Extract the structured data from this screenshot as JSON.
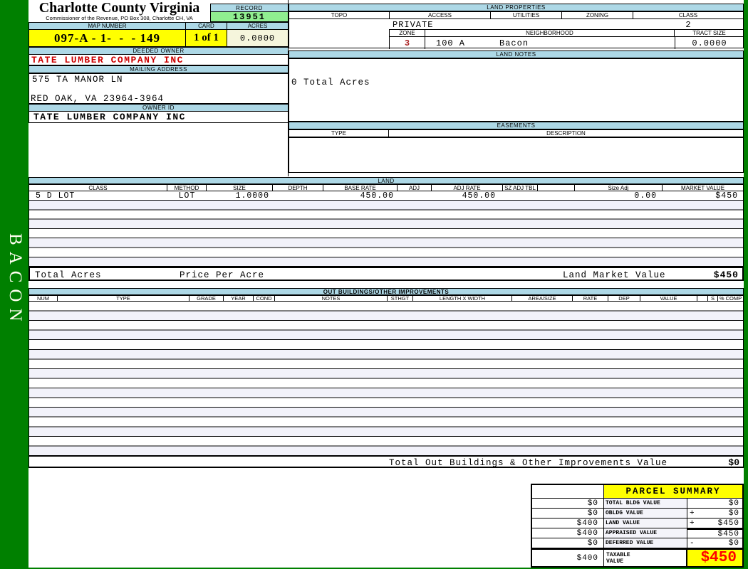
{
  "page": {
    "sidebar_text": "BACON"
  },
  "colors": {
    "frame_green": "#008000",
    "header_blue": "#ADD8E6",
    "highlight_yellow": "#FFFF00",
    "record_green": "#90EE90",
    "acres_cream": "#F5F5DC",
    "owner_red": "#CC0000",
    "taxable_red": "#FF0000"
  },
  "header": {
    "county": "Charlotte County Virginia",
    "commissioner": "Commissioner of the Revenue, PO Box 308, Charlotte CH, VA"
  },
  "record": {
    "label": "RECORD",
    "value": "13951"
  },
  "map": {
    "label": "MAP NUMBER",
    "value": "097-A - 1-  -  - 149"
  },
  "card": {
    "label": "CARD",
    "value": "1 of 1"
  },
  "acres": {
    "label": "ACRES",
    "value": "0.0000"
  },
  "deeded_owner": {
    "label": "DEEDED OWNER",
    "value": "TATE LUMBER COMPANY INC"
  },
  "mailing": {
    "label": "MAILING ADDRESS",
    "line1": "575 TA MANOR LN",
    "line2": "RED OAK, VA 23964-3964"
  },
  "owner_id": {
    "label": "OWNER ID",
    "value": "TATE LUMBER COMPANY INC"
  },
  "land_properties": {
    "title": "LAND PROPERTIES",
    "headers": [
      "TOPO",
      "ACCESS",
      "UTILITIES",
      "ZONING",
      "CLASS"
    ],
    "access_value": "PRIVATE",
    "class_value": "2",
    "zone_label": "ZONE",
    "zone_value": "3",
    "neighborhood_label": "NEIGHBORHOOD",
    "neighborhood_code": "100 A",
    "neighborhood_name": "Bacon",
    "tract_label": "TRACT SIZE",
    "tract_value": "0.0000"
  },
  "land_notes": {
    "title": "LAND NOTES",
    "text": "0 Total Acres"
  },
  "easements": {
    "title": "EASEMENTS",
    "type_label": "TYPE",
    "description_label": "DESCRIPTION"
  },
  "land_table": {
    "title": "LAND",
    "headers": [
      "CLASS",
      "METHOD",
      "SIZE",
      "DEPTH",
      "BASE RATE",
      "ADJ",
      "ADJ RATE",
      "SZ ADJ TBL",
      "",
      "Size Adj",
      "MARKET VALUE"
    ],
    "row": {
      "class": "5 D LOT",
      "method": "LOT",
      "size": "1.0000",
      "base_rate": "450.00",
      "adj_rate": "450.00",
      "size_adj": "0.00",
      "market_value": "$450"
    },
    "totals": {
      "total_acres_label": "Total Acres",
      "price_per_acre_label": "Price Per Acre",
      "market_label": "Land Market Value",
      "market_value": "$450"
    }
  },
  "out_buildings": {
    "title": "OUT BUILDINGS/OTHER IMPROVEMENTS",
    "headers": [
      "NUM",
      "TYPE",
      "GRADE",
      "YEAR",
      "COND",
      "NOTES",
      "STHGT",
      "LENGTH X WIDTH",
      "AREA/SIZE",
      "RATE",
      "DEP",
      "VALUE",
      "",
      "S",
      "% COMP"
    ],
    "total_label": "Total Out Buildings & Other Improvements Value",
    "total_value": "$0"
  },
  "parcel_summary": {
    "title": "PARCEL SUMMARY",
    "rows": [
      {
        "prev": "$0",
        "label": "TOTAL BLDG VALUE",
        "op": "",
        "value": "$0"
      },
      {
        "prev": "$0",
        "label": "OBLDG VALUE",
        "op": "+",
        "value": "$0"
      },
      {
        "prev": "$400",
        "label": "LAND VALUE",
        "op": "+",
        "value": "$450"
      },
      {
        "prev": "$400",
        "label": "APPRAISED VALUE",
        "op": "",
        "value": "$450"
      },
      {
        "prev": "$0",
        "label": "DEFERRED VALUE",
        "op": "-",
        "value": "$0"
      }
    ],
    "taxable": {
      "prev": "$400",
      "label_line1": "TAXABLE",
      "label_line2": "VALUE",
      "value": "$450"
    }
  }
}
